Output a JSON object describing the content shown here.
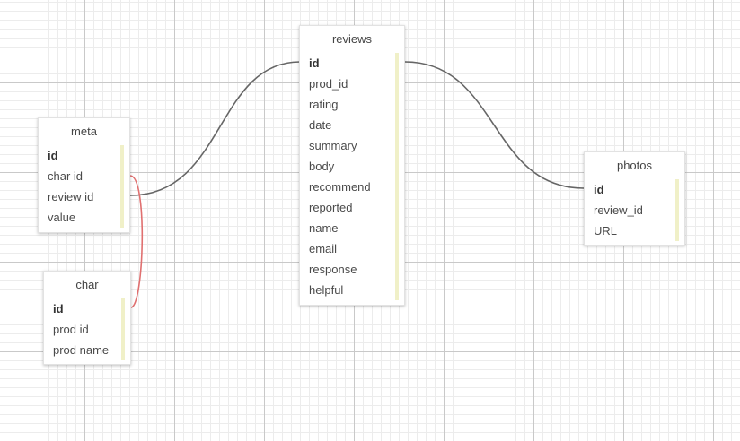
{
  "tables": {
    "meta": {
      "title": "meta",
      "fields": [
        "id",
        "char id",
        "review id",
        "value"
      ]
    },
    "char": {
      "title": "char",
      "fields": [
        "id",
        "prod id",
        "prod name"
      ]
    },
    "reviews": {
      "title": "reviews",
      "fields": [
        "id",
        "prod_id",
        "rating",
        "date",
        "summary",
        "body",
        "recommend",
        "reported",
        "name",
        "email",
        "response",
        "helpful"
      ]
    },
    "photos": {
      "title": "photos",
      "fields": [
        "id",
        "review_id",
        "URL"
      ]
    }
  },
  "connectors": [
    {
      "from": "meta.review id",
      "to": "reviews.id",
      "color": "#666666"
    },
    {
      "from": "reviews.id",
      "to": "photos.id",
      "color": "#666666"
    },
    {
      "from": "meta.char id",
      "to": "char.id",
      "color": "#e07070"
    }
  ],
  "colors": {
    "scrollbar": "#f0f0c8",
    "connector": "#666666",
    "connector_selected": "#e07070"
  }
}
